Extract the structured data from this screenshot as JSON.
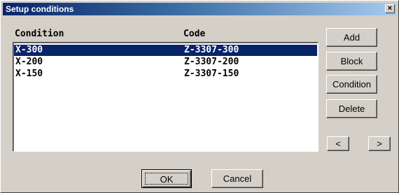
{
  "window": {
    "title": "Setup conditions",
    "close_glyph": "×"
  },
  "table": {
    "columns": [
      "Condition",
      "Code"
    ],
    "rows": [
      {
        "condition": "X-300",
        "code": "Z-3307-300",
        "selected": true
      },
      {
        "condition": "X-200",
        "code": "Z-3307-200",
        "selected": false
      },
      {
        "condition": "X-150",
        "code": "Z-3307-150",
        "selected": false
      }
    ]
  },
  "buttons": {
    "add": "Add",
    "block": "Block",
    "condition": "Condition",
    "delete": "Delete",
    "prev": "<",
    "next": ">",
    "ok": "OK",
    "cancel": "Cancel"
  },
  "colors": {
    "dialog_bg": "#d4d0c8",
    "title_bar_start": "#0a246a",
    "title_bar_end": "#a6caf0",
    "selection": "#0a246a"
  }
}
